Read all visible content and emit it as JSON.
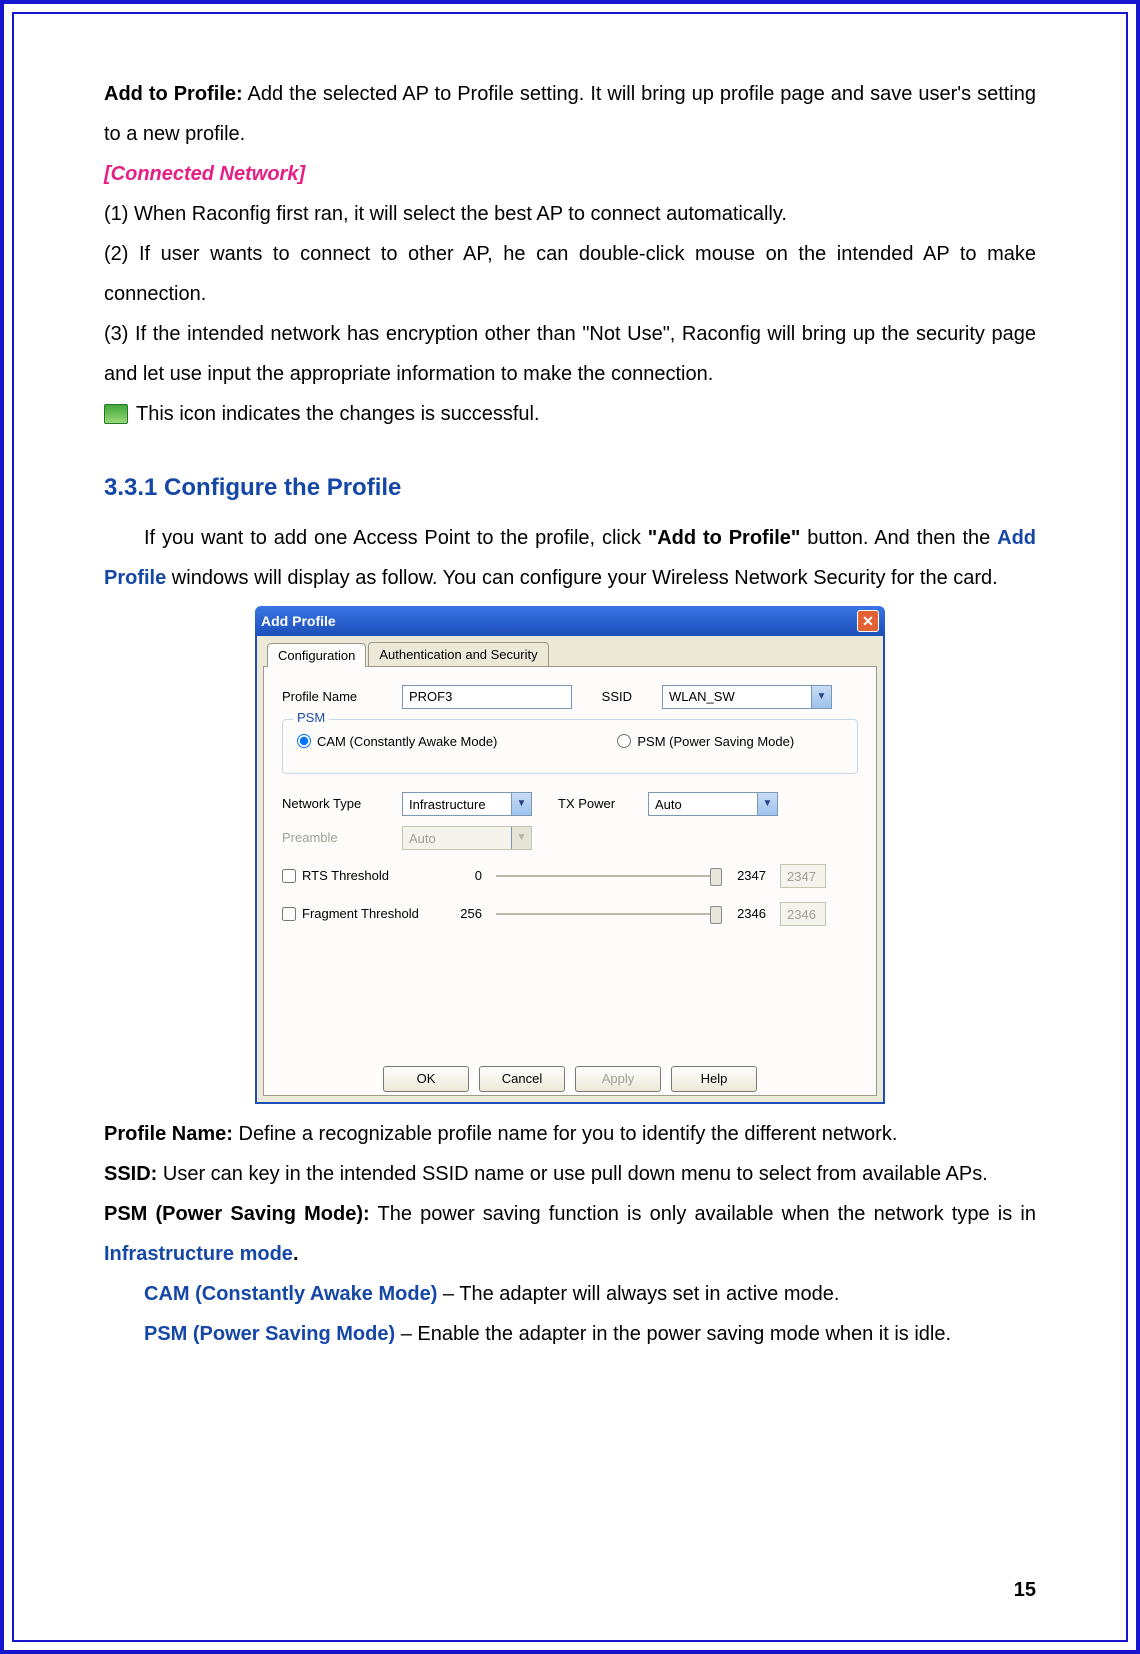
{
  "page_number": "15",
  "para1_label": "Add to Profile:",
  "para1_text": " Add the selected AP to Profile setting. It will bring up profile page and save user's setting to a new profile.",
  "connected_network": "[Connected Network]",
  "cn_1": "(1) When Raconfig first ran, it will select the best AP to connect automatically.",
  "cn_2": "(2) If user wants to connect to other AP, he can double-click mouse on the intended AP to make connection.",
  "cn_3": "(3) If the intended network has encryption other than \"Not Use\", Raconfig will bring up the security page and let use input the appropriate information to make the connection.",
  "icon_text": " This icon indicates the changes is successful.",
  "section_title": "3.3.1 Configure the Profile",
  "sec_intro_1a": "If you want to add one Access Point to the profile, click ",
  "sec_intro_1b": "\"Add to Profile\"",
  "sec_intro_1c": " button. And then the ",
  "sec_intro_1d": "Add Profile",
  "sec_intro_1e": " windows will display as follow. You can configure your Wireless Network Security for the card.",
  "dialog": {
    "title": "Add Profile",
    "tabs": {
      "configuration": "Configuration",
      "auth": "Authentication and Security"
    },
    "labels": {
      "profile_name": "Profile Name",
      "ssid": "SSID",
      "psm_group": "PSM",
      "cam": "CAM (Constantly Awake Mode)",
      "psm": "PSM (Power Saving Mode)",
      "network_type": "Network Type",
      "tx_power": "TX Power",
      "preamble": "Preamble",
      "rts": "RTS Threshold",
      "fragment": "Fragment Threshold"
    },
    "values": {
      "profile_name": "PROF3",
      "ssid": "WLAN_SW",
      "network_type": "Infrastructure",
      "tx_power": "Auto",
      "preamble": "Auto",
      "rts_min": "0",
      "rts_max": "2347",
      "rts_val": "2347",
      "frag_min": "256",
      "frag_max": "2346",
      "frag_val": "2346"
    },
    "buttons": {
      "ok": "OK",
      "cancel": "Cancel",
      "apply": "Apply",
      "help": "Help"
    }
  },
  "desc": {
    "profile_name_label": "Profile Name:",
    "profile_name_text": " Define a recognizable profile name for you to identify the different network.",
    "ssid_label": "SSID:",
    "ssid_text": " User can key in the intended SSID name or use pull down menu to select from available APs.",
    "psm_label": "PSM (Power Saving Mode):",
    "psm_text_a": " The power saving function is only available when the network type is in ",
    "psm_text_b": "Infrastructure mode",
    "psm_text_c": ".",
    "cam_label": "CAM (Constantly Awake Mode)",
    "cam_text": " – The adapter will always set in active mode.",
    "psm2_label": "PSM (Power Saving Mode)",
    "psm2_text": " – Enable the adapter in the power saving mode when it is idle."
  }
}
